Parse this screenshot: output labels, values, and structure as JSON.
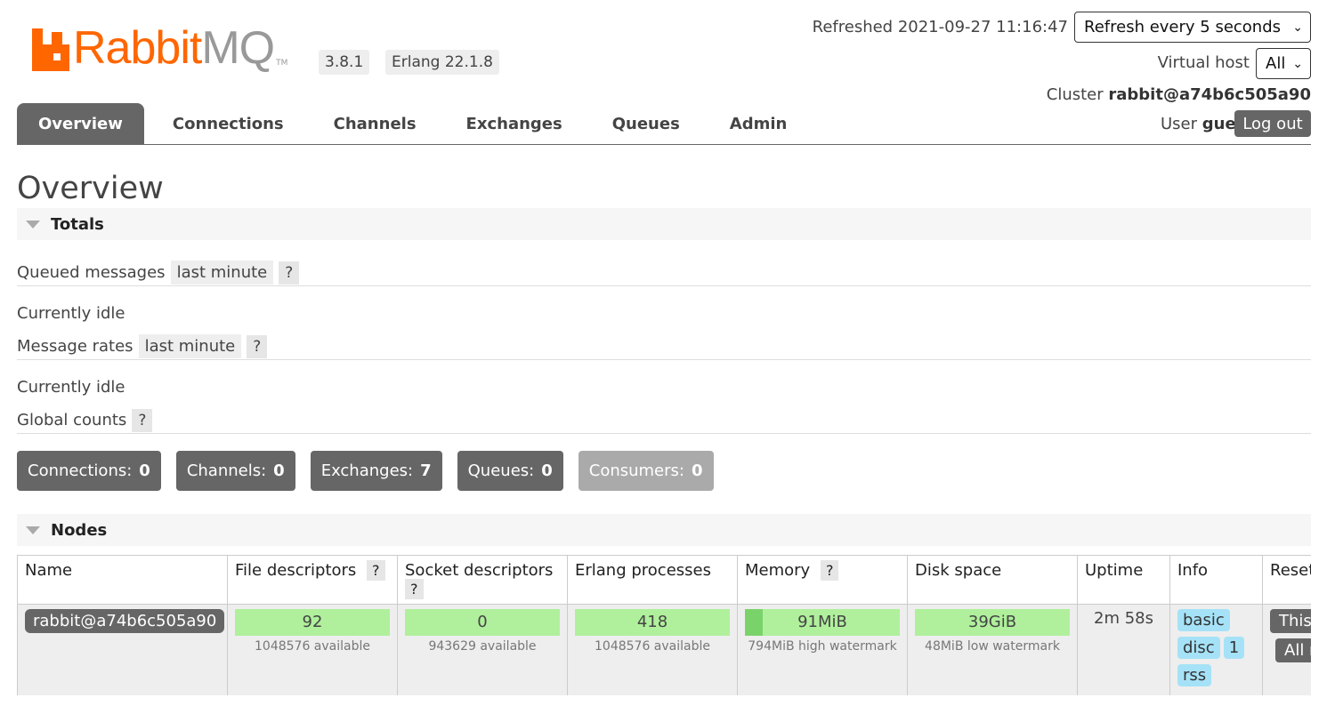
{
  "header": {
    "logo": {
      "rabbit": "Rabbit",
      "mq": "MQ",
      "tm": "TM"
    },
    "version": "3.8.1",
    "erlang": "Erlang 22.1.8",
    "refreshed": "Refreshed 2021-09-27 11:16:47",
    "refresh_select": "Refresh every 5 seconds",
    "vhost_label": "Virtual host",
    "vhost_select": "All",
    "cluster_label": "Cluster",
    "cluster_name": "rabbit@a74b6c505a90",
    "user_label": "User",
    "user_name": "guest",
    "logout_label": "Log out"
  },
  "tabs": [
    "Overview",
    "Connections",
    "Channels",
    "Exchanges",
    "Queues",
    "Admin"
  ],
  "page_title": "Overview",
  "totals": {
    "title": "Totals",
    "queued_label": "Queued messages",
    "queued_range": "last minute",
    "queued_status": "Currently idle",
    "rates_label": "Message rates",
    "rates_range": "last minute",
    "rates_status": "Currently idle",
    "global_label": "Global counts",
    "help": "?"
  },
  "counts": [
    {
      "label": "Connections:",
      "value": "0"
    },
    {
      "label": "Channels:",
      "value": "0"
    },
    {
      "label": "Exchanges:",
      "value": "7"
    },
    {
      "label": "Queues:",
      "value": "0"
    },
    {
      "label": "Consumers:",
      "value": "0"
    }
  ],
  "nodes": {
    "title": "Nodes",
    "columns": {
      "name": "Name",
      "fd": "File descriptors",
      "sd": "Socket descriptors",
      "ep": "Erlang processes",
      "mem": "Memory",
      "disk": "Disk space",
      "uptime": "Uptime",
      "info": "Info",
      "reset": "Reset stats"
    },
    "row": {
      "name": "rabbit@a74b6c505a90",
      "fd_value": "92",
      "fd_sub": "1048576 available",
      "sd_value": "0",
      "sd_sub": "943629 available",
      "ep_value": "418",
      "ep_sub": "1048576 available",
      "mem_value": "91MiB",
      "mem_sub": "794MiB high watermark",
      "mem_fraction": 0.115,
      "disk_value": "39GiB",
      "disk_sub": "48MiB low watermark",
      "uptime": "2m 58s",
      "info_basic": "basic",
      "info_disc": "disc",
      "info_count": "1",
      "info_rss": "rss",
      "reset_this": "This node",
      "reset_all": "All nodes"
    }
  },
  "colors": {
    "brand_orange": "#ff6600",
    "bar_green": "#b0f09c",
    "info_blue": "#a6e2f7",
    "dark_gray": "#666666"
  }
}
